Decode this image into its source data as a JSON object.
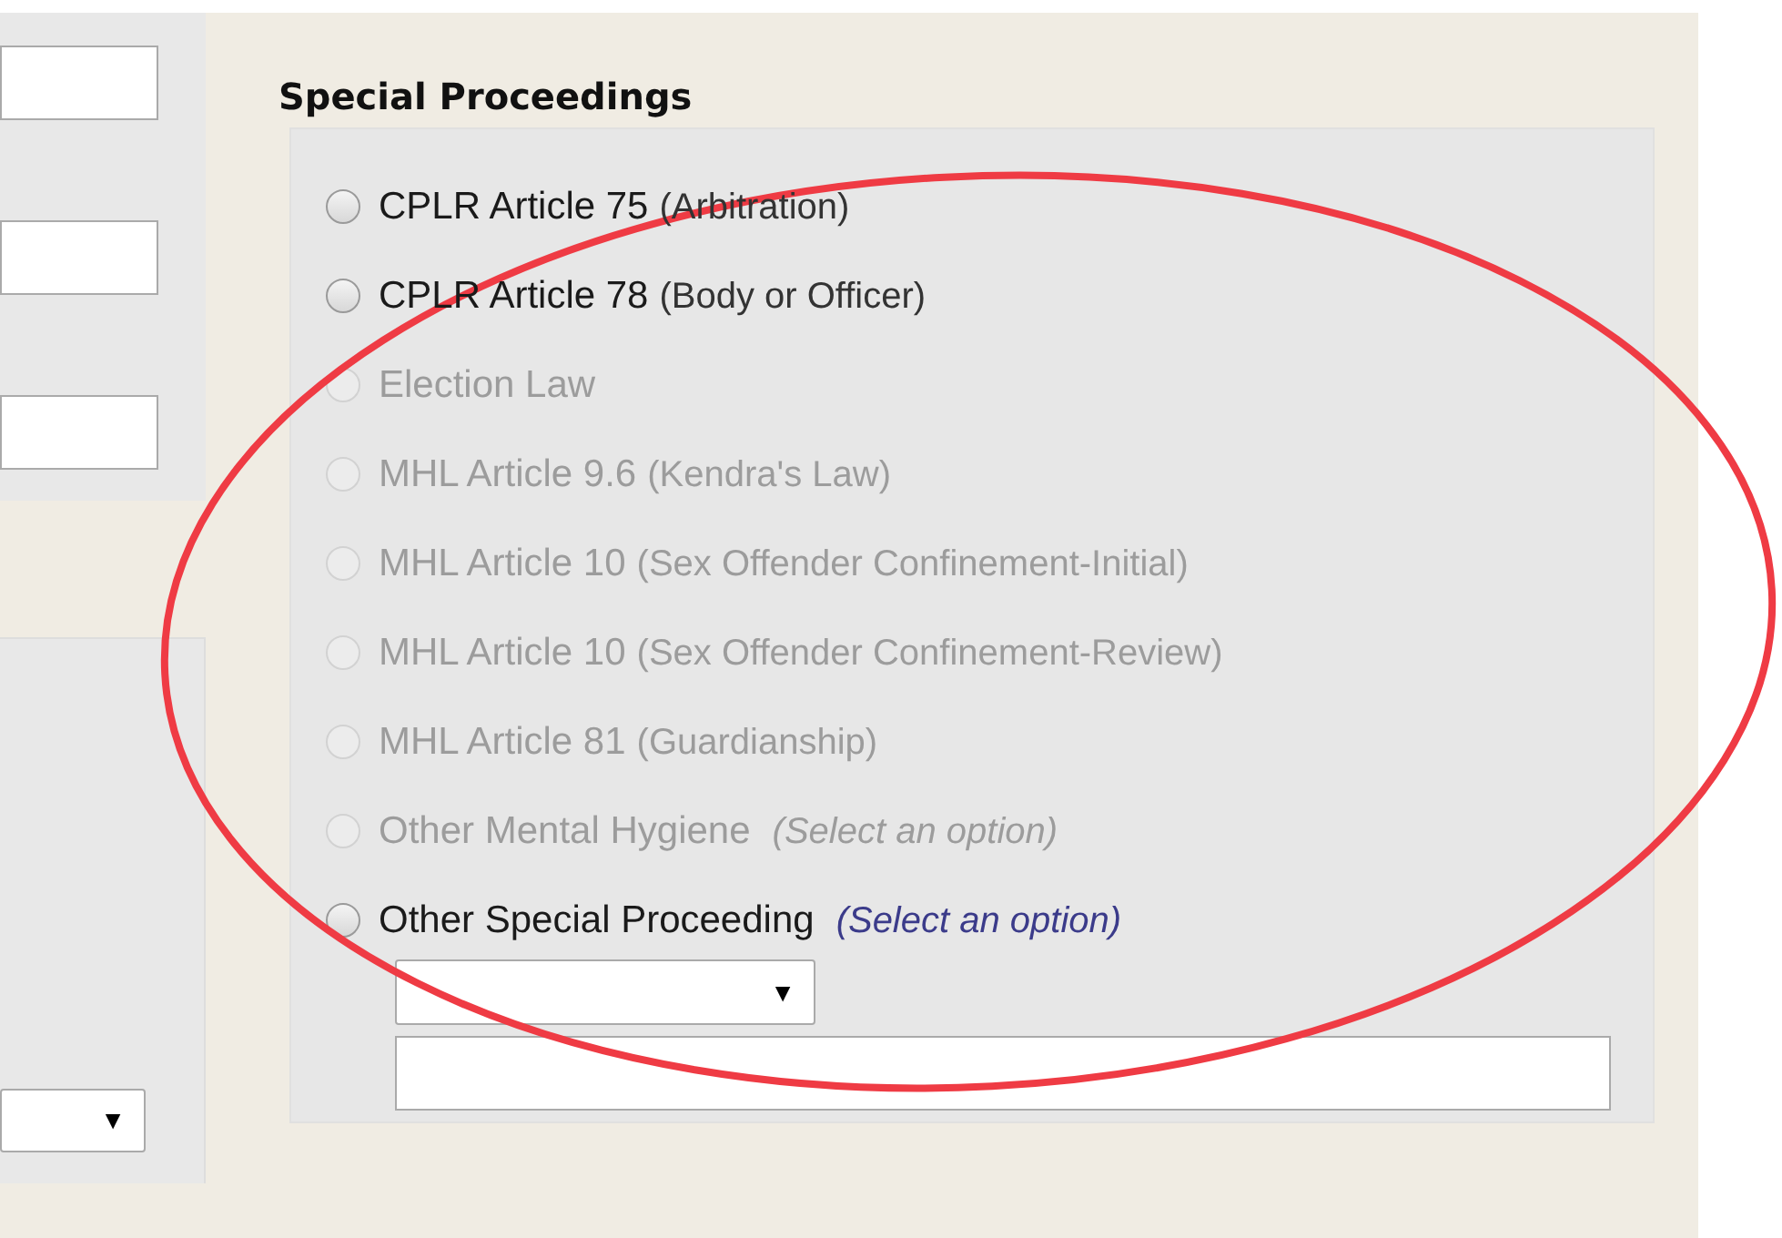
{
  "left_fields": [
    {
      "kind": "text"
    },
    {
      "kind": "text"
    },
    {
      "kind": "text"
    }
  ],
  "left_lower": {
    "dropdown": {
      "arrow": "▼"
    }
  },
  "section": {
    "title": "Special Proceedings",
    "options": [
      {
        "label": "CPLR Article 75",
        "note": "(Arbitration)",
        "disabled": false,
        "selected": false
      },
      {
        "label": "CPLR Article 78",
        "note": "(Body or Officer)",
        "disabled": false,
        "selected": false
      },
      {
        "label": "Election Law",
        "disabled": true,
        "selected": false
      },
      {
        "label": "MHL Article 9.6",
        "note": "(Kendra's Law)",
        "disabled": true,
        "selected": false
      },
      {
        "label": "MHL Article 10",
        "note": "(Sex Offender Confinement-Initial)",
        "disabled": true,
        "selected": false
      },
      {
        "label": "MHL Article 10",
        "note": "(Sex Offender Confinement-Review)",
        "disabled": true,
        "selected": false
      },
      {
        "label": "MHL Article 81",
        "note": "(Guardianship)",
        "disabled": true,
        "selected": false
      },
      {
        "label": "Other Mental Hygiene",
        "hint": "(Select an option)",
        "disabled": true,
        "selected": false
      },
      {
        "label": "Other Special Proceeding",
        "hint": "(Select an option)",
        "disabled": false,
        "selected": false
      }
    ],
    "dropdown": {
      "arrow": "▼"
    },
    "text_field": {
      "kind": "text"
    }
  },
  "annotation": {
    "kind": "ellipse"
  }
}
